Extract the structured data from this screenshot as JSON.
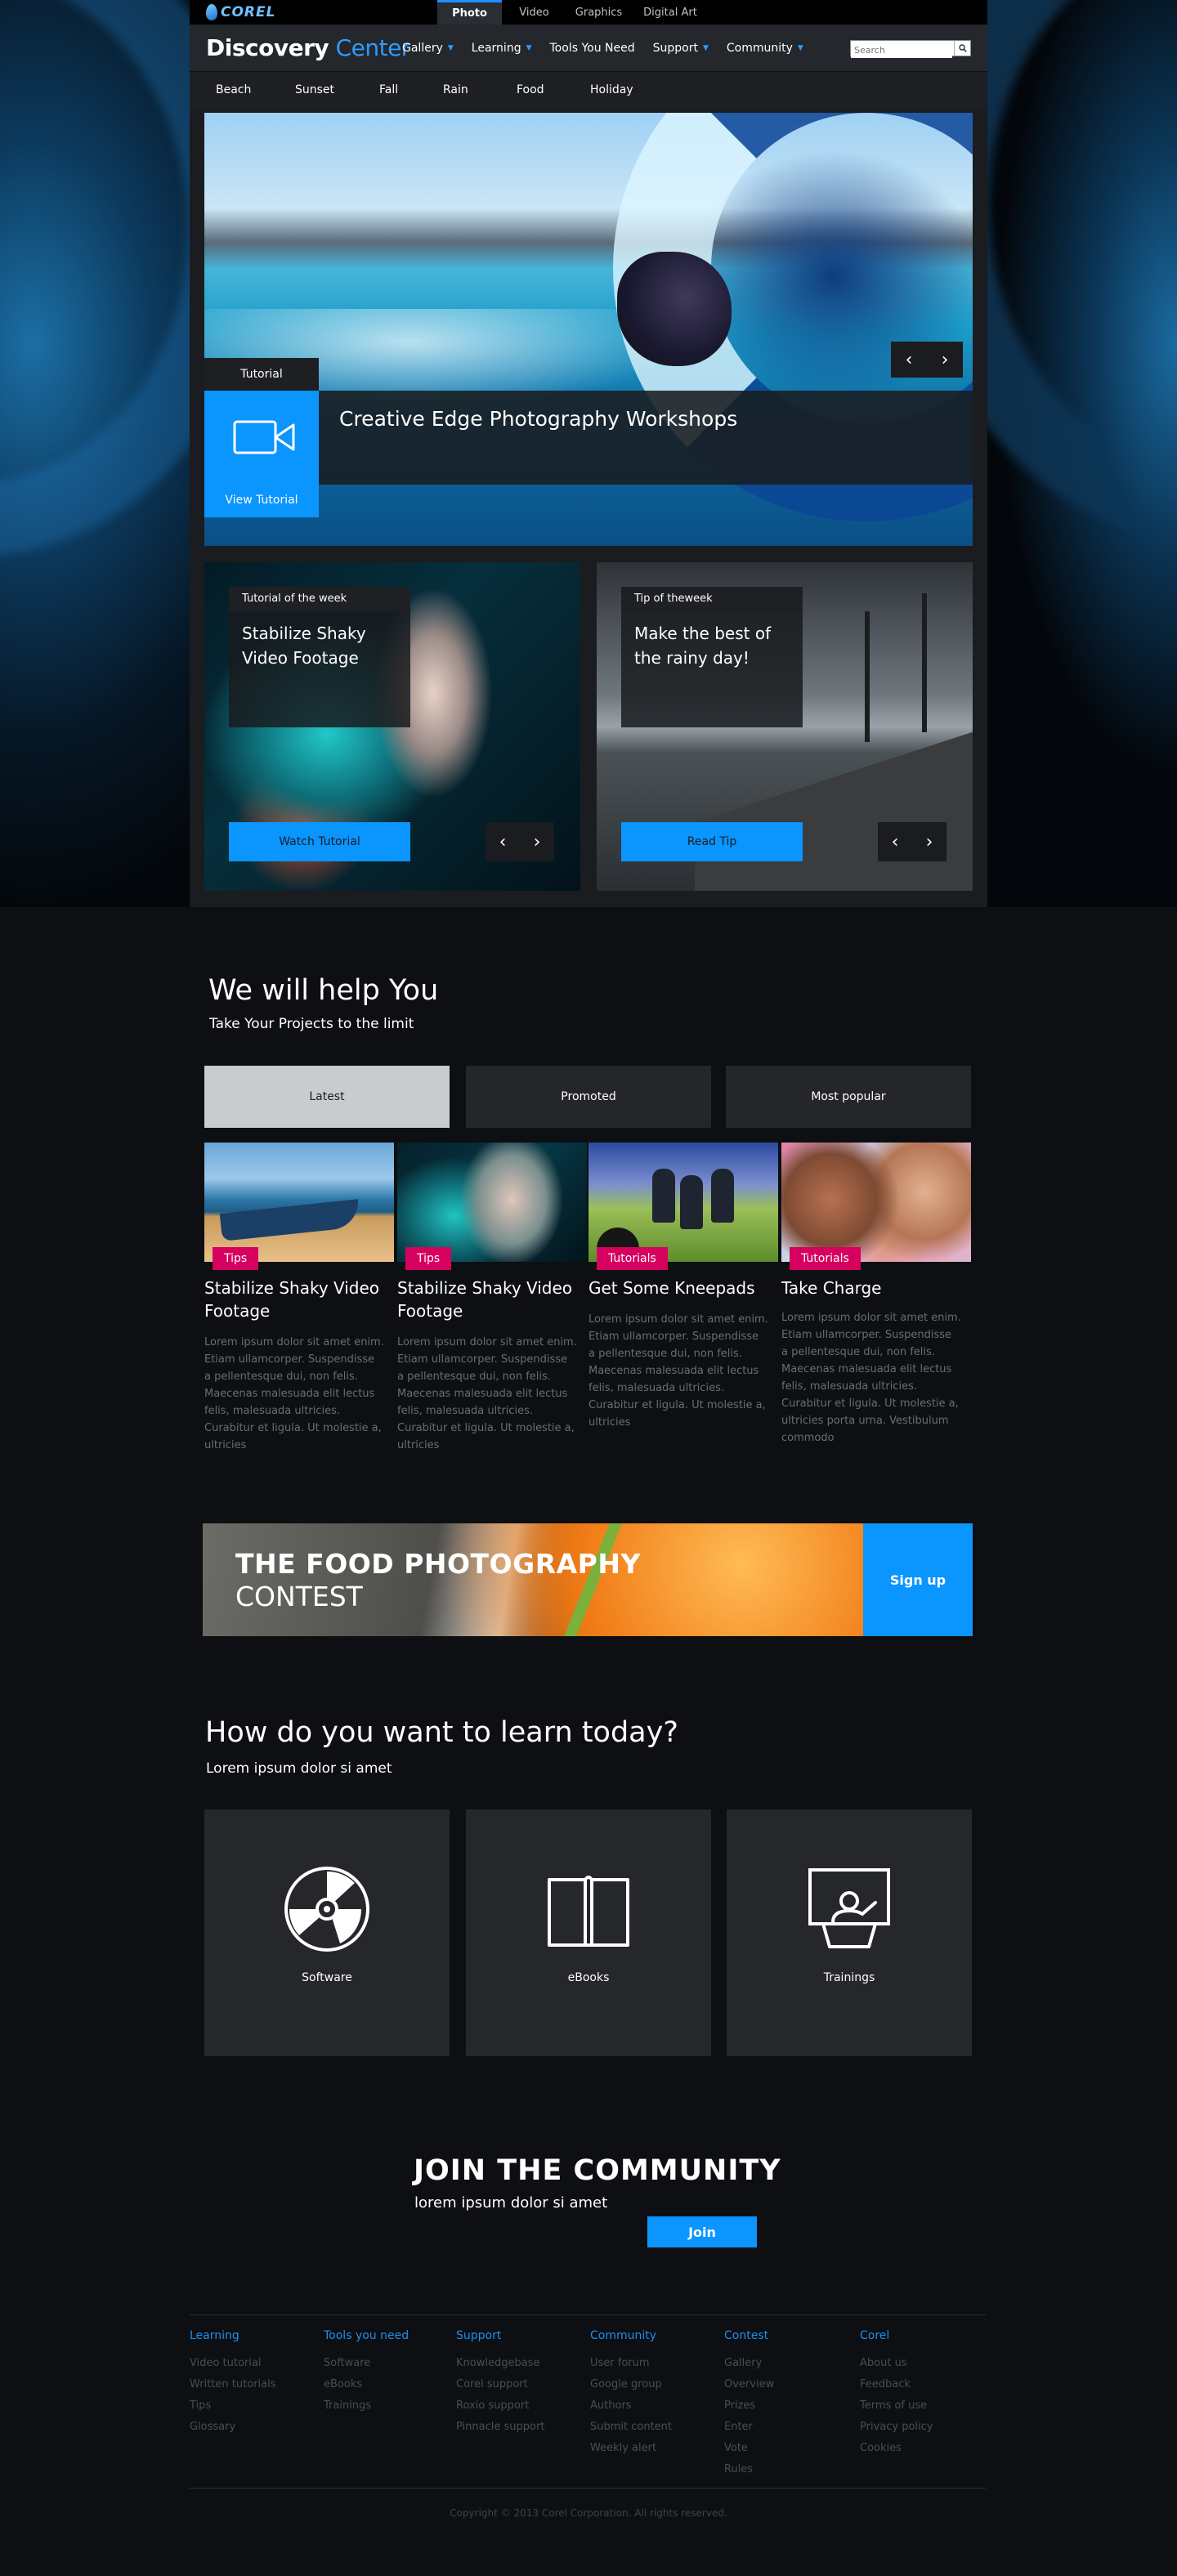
{
  "brand": {
    "logo_text": "COREL"
  },
  "product_tabs": [
    "Photo",
    "Video",
    "Graphics",
    "Digital Art"
  ],
  "header": {
    "title_part1": "Discovery",
    "title_part2": "Center",
    "nav": [
      "Gallery",
      "Learning",
      "Tools You Need",
      "Support",
      "Community"
    ],
    "search_placeholder": "Search"
  },
  "categories": [
    "Beach",
    "Sunset",
    "Fall",
    "Rain",
    "Food",
    "Holiday"
  ],
  "hero": {
    "tab_label": "Tutorial",
    "cta_label": "View Tutorial",
    "headline": "Creative Edge Photography Workshops",
    "prev": "‹",
    "next": "›"
  },
  "features": [
    {
      "kicker": "Tutorial of the week",
      "title": "Stabilize Shaky Video Footage",
      "cta": "Watch Tutorial"
    },
    {
      "kicker": "Tip of theweek",
      "title": "Make the best of the rainy day!",
      "cta": "Read Tip"
    }
  ],
  "help": {
    "title": "We will help You",
    "subtitle": "Take Your Projects to the limit",
    "tabs": [
      "Latest",
      "Promoted",
      "Most popular"
    ],
    "posts": [
      {
        "tag": "Tips",
        "title": "Stabilize Shaky Video Footage",
        "body": "Lorem ipsum dolor sit amet enim. Etiam ullamcorper. Suspendisse a pellentesque dui, non felis. Maecenas malesuada elit lectus felis, malesuada ultricies. Curabitur et ligula. Ut molestie a, ultricies"
      },
      {
        "tag": "Tips",
        "title": "Stabilize Shaky Video Footage",
        "body": "Lorem ipsum dolor sit amet enim. Etiam ullamcorper. Suspendisse a pellentesque dui, non felis. Maecenas malesuada elit lectus felis, malesuada ultricies. Curabitur et ligula. Ut molestie a, ultricies"
      },
      {
        "tag": "Tutorials",
        "title": "Get Some Kneepads",
        "body": "Lorem ipsum dolor sit amet enim. Etiam ullamcorper. Suspendisse a pellentesque dui, non felis. Maecenas malesuada elit lectus felis, malesuada ultricies. Curabitur et ligula. Ut molestie a, ultricies"
      },
      {
        "tag": "Tutorials",
        "title": "Take Charge",
        "body": "Lorem ipsum dolor sit amet enim. Etiam ullamcorper. Suspendisse a pellentesque dui, non felis. Maecenas malesuada elit lectus felis, malesuada ultricies. Curabitur et ligula. Ut molestie a, ultricies porta urna. Vestibulum commodo"
      }
    ]
  },
  "banner": {
    "line1": "THE FOOD PHOTOGRAPHY",
    "line2": "CONTEST",
    "cta": "Sign up"
  },
  "learn": {
    "title": "How do you want to learn today?",
    "subtitle": "Lorem ipsum dolor si amet",
    "cards": [
      "Software",
      "eBooks",
      "Trainings"
    ]
  },
  "community": {
    "title": "JOIN THE COMMUNITY",
    "subtitle": "lorem ipsum dolor si amet",
    "cta": "Join"
  },
  "footer": {
    "columns": [
      {
        "heading": "Learning",
        "links": [
          "Video tutorial",
          "Written tutorials",
          "Tips",
          "Glossary"
        ]
      },
      {
        "heading": "Tools you need",
        "links": [
          "Software",
          "eBooks",
          "Trainings"
        ]
      },
      {
        "heading": "Support",
        "links": [
          "Knowledgebase",
          "Corel support",
          "Roxio support",
          "Pinnacle support"
        ]
      },
      {
        "heading": "Community",
        "links": [
          "User forum",
          "Google group",
          "Authors",
          "Submit content",
          "Weekly alert"
        ]
      },
      {
        "heading": "Contest",
        "links": [
          "Gallery",
          "Overview",
          "Prizes",
          "Enter",
          "Vote",
          "Rules"
        ]
      },
      {
        "heading": "Corel",
        "links": [
          "About us",
          "Feedback",
          "Terms of use",
          "Privacy policy",
          "Cookies"
        ]
      }
    ],
    "copyright": "Copyright © 2013 Corel Corporation. All rights reserved."
  },
  "colors": {
    "accent": "#0a95ff",
    "tag": "#d6005f",
    "link_heading": "#1c8ff0"
  }
}
